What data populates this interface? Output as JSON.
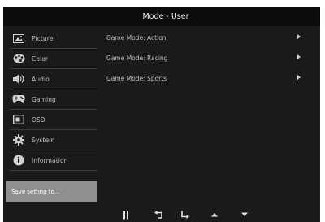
{
  "title": "Mode - User",
  "sidebar": {
    "items": [
      {
        "label": "Picture",
        "icon": "picture-icon"
      },
      {
        "label": "Color",
        "icon": "palette-icon"
      },
      {
        "label": "Audio",
        "icon": "speaker-icon"
      },
      {
        "label": "Gaming",
        "icon": "gamepad-icon"
      },
      {
        "label": "OSD",
        "icon": "osd-icon"
      },
      {
        "label": "System",
        "icon": "gear-icon"
      },
      {
        "label": "Information",
        "icon": "info-icon"
      }
    ],
    "save_label": "Save setting to..."
  },
  "content": {
    "rows": [
      {
        "label": "Game Mode: Action"
      },
      {
        "label": "Game Mode: Racing"
      },
      {
        "label": "Game Mode: Sports"
      }
    ]
  },
  "bottom_buttons": [
    {
      "icon": "power-icon"
    },
    {
      "icon": "back-icon"
    },
    {
      "icon": "enter-icon"
    },
    {
      "icon": "up-arrow-icon"
    },
    {
      "icon": "down-arrow-icon"
    }
  ],
  "colors": {
    "panel_bg": "#1a1a1a",
    "title_bg": "#0d0d0d",
    "selected_bg": "#8f8f8f",
    "text": "#bfbfbf"
  }
}
